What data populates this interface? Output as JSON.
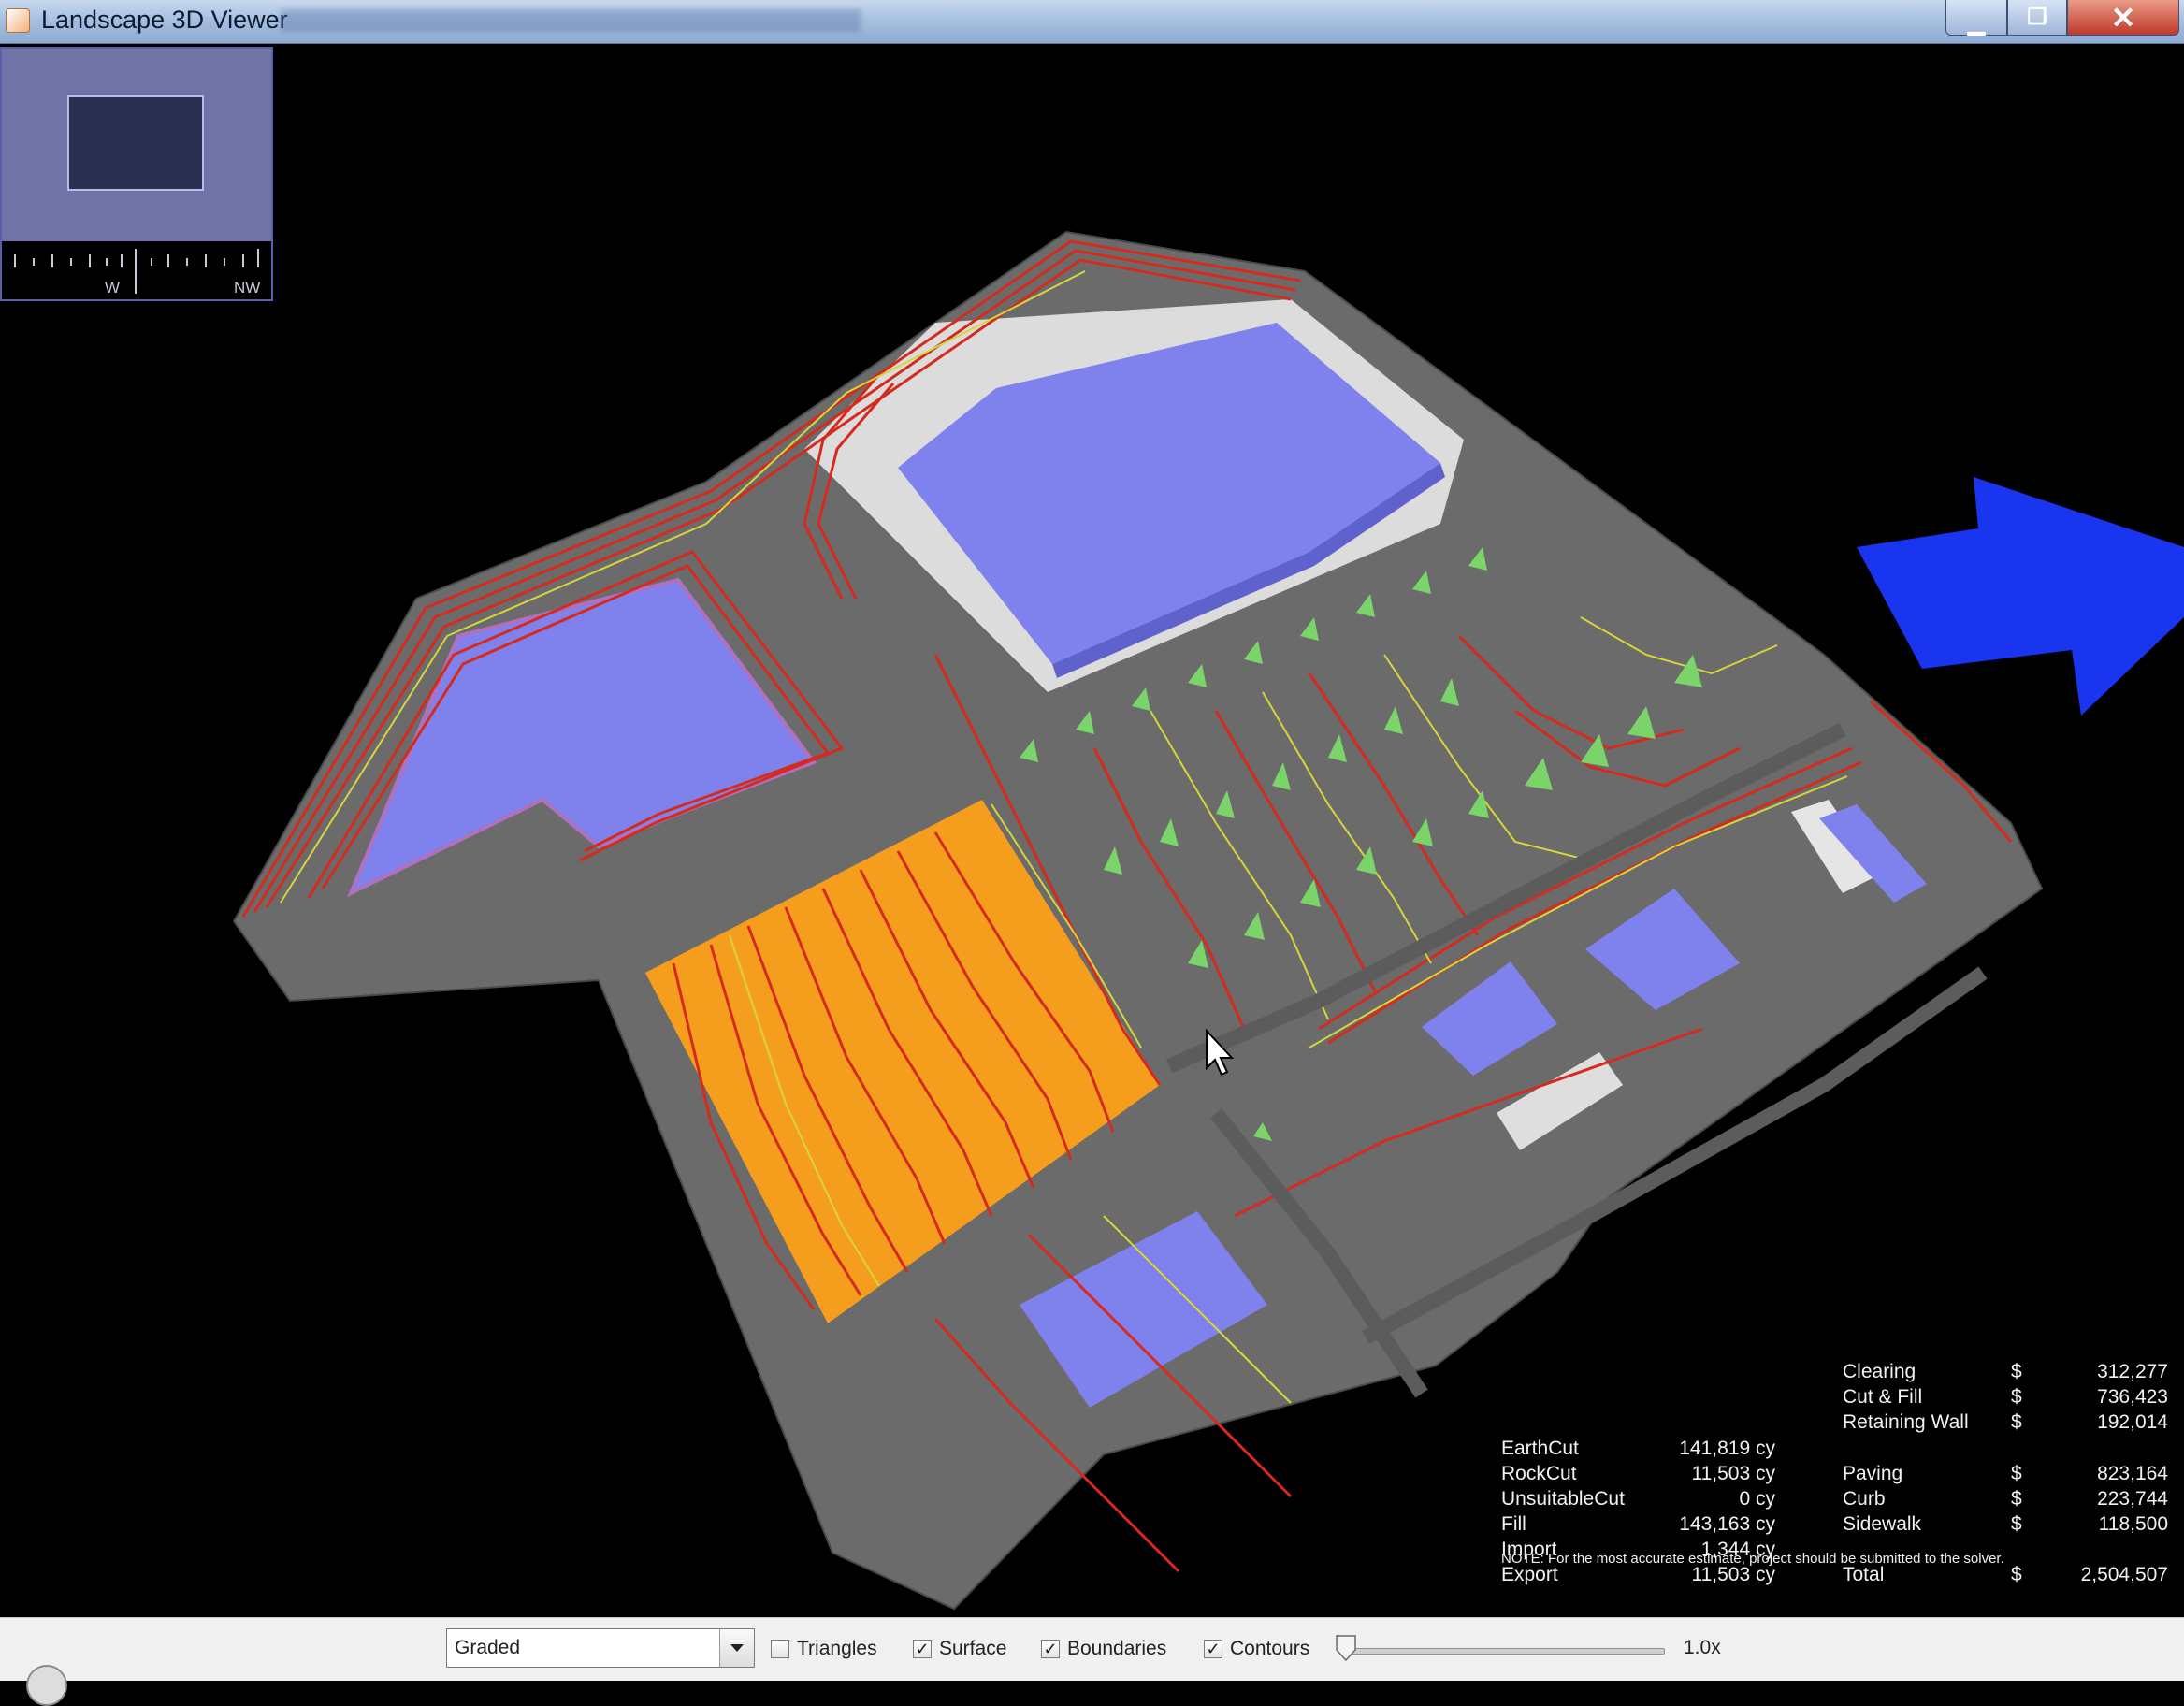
{
  "window": {
    "title": "Landscape 3D Viewer",
    "controls": {
      "minimize": "▁",
      "maximize": "❐",
      "close": "✕"
    }
  },
  "navigator": {
    "compass_labels": [
      "W",
      "NW"
    ]
  },
  "quantities": [
    {
      "label": "EarthCut",
      "value": "141,819 cy"
    },
    {
      "label": "RockCut",
      "value": "11,503 cy"
    },
    {
      "label": "UnsuitableCut",
      "value": "0 cy"
    },
    {
      "label": "Fill",
      "value": "143,163 cy"
    },
    {
      "label": "Import",
      "value": "1,344 cy"
    },
    {
      "label": "Export",
      "value": "11,503 cy"
    }
  ],
  "costs_top": [
    {
      "label": "Clearing",
      "currency": "$",
      "value": "312,277"
    },
    {
      "label": "Cut & Fill",
      "currency": "$",
      "value": "736,423"
    },
    {
      "label": "Retaining Wall",
      "currency": "$",
      "value": "192,014"
    }
  ],
  "costs_bottom": [
    {
      "label": "Paving",
      "currency": "$",
      "value": "823,164"
    },
    {
      "label": "Curb",
      "currency": "$",
      "value": "223,744"
    },
    {
      "label": "Sidewalk",
      "currency": "$",
      "value": "118,500"
    }
  ],
  "total": {
    "label": "Total",
    "currency": "$",
    "value": "2,504,507"
  },
  "note": "NOTE: For the most accurate estimate, project should be submitted to the solver.",
  "toolbar": {
    "view_mode": "Graded",
    "checkboxes": [
      {
        "label": "Triangles",
        "checked": false
      },
      {
        "label": "Surface",
        "checked": true
      },
      {
        "label": "Boundaries",
        "checked": true
      },
      {
        "label": "Contours",
        "checked": true
      }
    ],
    "zoom_label": "1.0x",
    "zoom_slider_fraction": 0.0
  },
  "colors": {
    "terrain": "#6b6b6b",
    "building": "#7f82ec",
    "graded_area": "#f59d1c",
    "contour_major": "#d42b1e",
    "contour_minor": "#d6d63a",
    "trees": "#7ad46a",
    "direction_arrow": "#1a35f0"
  }
}
